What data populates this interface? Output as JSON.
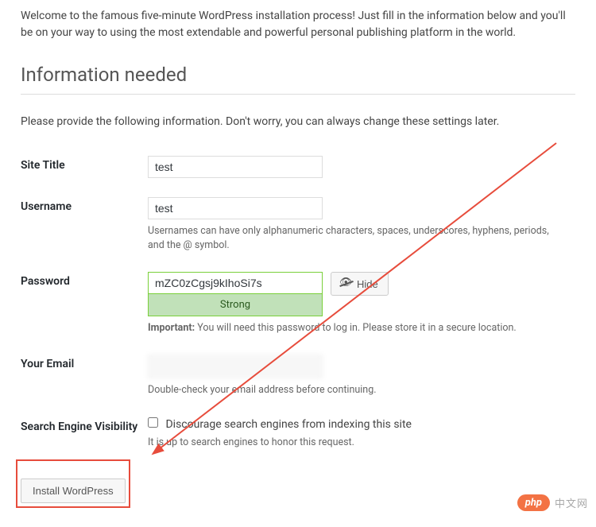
{
  "intro": "Welcome to the famous five-minute WordPress installation process! Just fill in the information below and you'll be on your way to using the most extendable and powerful personal publishing platform in the world.",
  "section_title": "Information needed",
  "section_sub": "Please provide the following information. Don't worry, you can always change these settings later.",
  "fields": {
    "site_title": {
      "label": "Site Title",
      "value": "test"
    },
    "username": {
      "label": "Username",
      "value": "test",
      "hint": "Usernames can have only alphanumeric characters, spaces, underscores, hyphens, periods, and the @ symbol."
    },
    "password": {
      "label": "Password",
      "value": "mZC0zCgsj9kIhoSi7s",
      "strength": "Strong",
      "hide_label": "Hide",
      "hint_prefix": "Important:",
      "hint": " You will need this password to log in. Please store it in a secure location."
    },
    "email": {
      "label": "Your Email",
      "hint": "Double-check your email address before continuing."
    },
    "search": {
      "label": "Search Engine Visibility",
      "checkbox_label": "Discourage search engines from indexing this site",
      "hint": "It is up to search engines to honor this request."
    }
  },
  "install_button": "Install WordPress",
  "watermark": {
    "brand": "php",
    "text": "中文网"
  }
}
